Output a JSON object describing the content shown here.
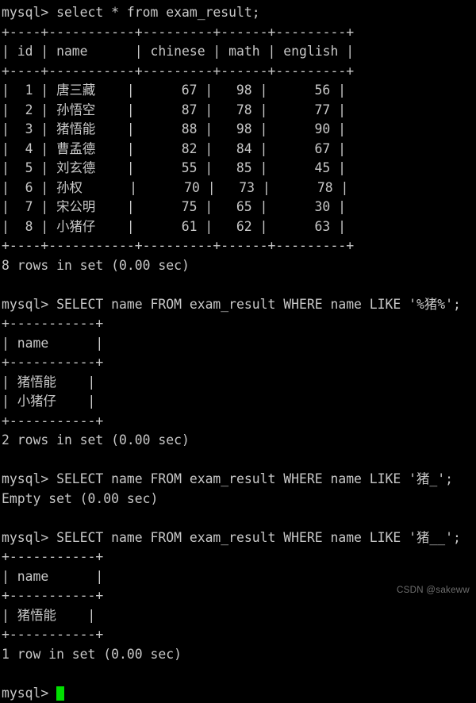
{
  "terminal": {
    "title": "mysql client session",
    "prompt": "mysql> ",
    "background_color": "#000000",
    "text_color": "#c8c8c8",
    "cursor_color": "#00e000",
    "watermark": "CSDN @sakeww",
    "lines": [
      "mysql> select * from exam_result;",
      "+----+-----------+---------+------+---------+",
      "| id | name      | chinese | math | english |",
      "+----+-----------+---------+------+---------+",
      "|  1 | 唐三藏    |      67 |   98 |      56 |",
      "|  2 | 孙悟空    |      87 |   78 |      77 |",
      "|  3 | 猪悟能    |      88 |   98 |      90 |",
      "|  4 | 曹孟德    |      82 |   84 |      67 |",
      "|  5 | 刘玄德    |      55 |   85 |      45 |",
      "|  6 | 孙权      |      70 |   73 |      78 |",
      "|  7 | 宋公明    |      75 |   65 |      30 |",
      "|  8 | 小猪仔    |      61 |   62 |      63 |",
      "+----+-----------+---------+------+---------+",
      "8 rows in set (0.00 sec)",
      "",
      "mysql> SELECT name FROM exam_result WHERE name LIKE '%猪%';",
      "+-----------+",
      "| name      |",
      "+-----------+",
      "| 猪悟能    |",
      "| 小猪仔    |",
      "+-----------+",
      "2 rows in set (0.00 sec)",
      "",
      "mysql> SELECT name FROM exam_result WHERE name LIKE '猪_';",
      "Empty set (0.00 sec)",
      "",
      "mysql> SELECT name FROM exam_result WHERE name LIKE '猪__';",
      "+-----------+",
      "| name      |",
      "+-----------+",
      "| 猪悟能    |",
      "+-----------+",
      "1 row in set (0.00 sec)",
      ""
    ],
    "queries": [
      {
        "sql": "select * from exam_result;",
        "result_status": "8 rows in set (0.00 sec)"
      },
      {
        "sql": "SELECT name FROM exam_result WHERE name LIKE '%猪%';",
        "result_status": "2 rows in set (0.00 sec)"
      },
      {
        "sql": "SELECT name FROM exam_result WHERE name LIKE '猪_';",
        "result_status": "Empty set (0.00 sec)"
      },
      {
        "sql": "SELECT name FROM exam_result WHERE name LIKE '猪__';",
        "result_status": "1 row in set (0.00 sec)"
      }
    ],
    "exam_result_table": {
      "columns": [
        "id",
        "name",
        "chinese",
        "math",
        "english"
      ],
      "rows": [
        [
          1,
          "唐三藏",
          67,
          98,
          56
        ],
        [
          2,
          "孙悟空",
          87,
          78,
          77
        ],
        [
          3,
          "猪悟能",
          88,
          98,
          90
        ],
        [
          4,
          "曹孟德",
          82,
          84,
          67
        ],
        [
          5,
          "刘玄德",
          55,
          85,
          45
        ],
        [
          6,
          "孙权",
          70,
          73,
          78
        ],
        [
          7,
          "宋公明",
          75,
          65,
          30
        ],
        [
          8,
          "小猪仔",
          61,
          62,
          63
        ]
      ]
    }
  }
}
